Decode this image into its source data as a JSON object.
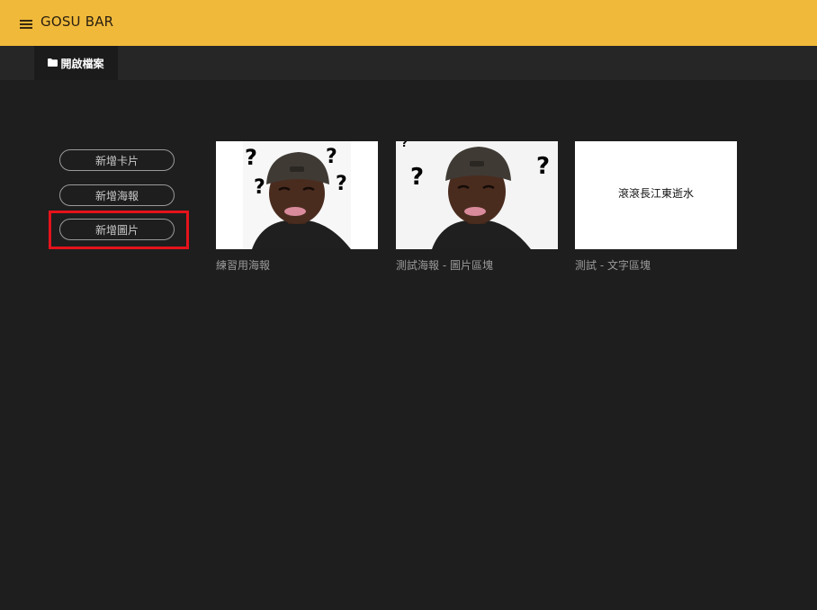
{
  "app": {
    "title": "GOSU BAR",
    "accent_color": "#f0b93a",
    "menu_icon": "hamburger-menu-icon"
  },
  "tabs": [
    {
      "label": "開啟檔案",
      "icon": "folder-icon",
      "active": true
    }
  ],
  "sidebar": {
    "buttons": [
      {
        "label": "新增卡片"
      },
      {
        "label": "新增海報"
      },
      {
        "label": "新增圖片",
        "highlighted": true
      }
    ],
    "highlight_color": "#e4131b"
  },
  "cards": [
    {
      "title": "練習用海報",
      "thumbnail": "confused-face-image"
    },
    {
      "title": "測試海報 - 圖片區塊",
      "thumbnail": "confused-face-image"
    },
    {
      "title": "測試 - 文字區塊",
      "thumbnail_text": "滾滾長江東逝水"
    }
  ]
}
